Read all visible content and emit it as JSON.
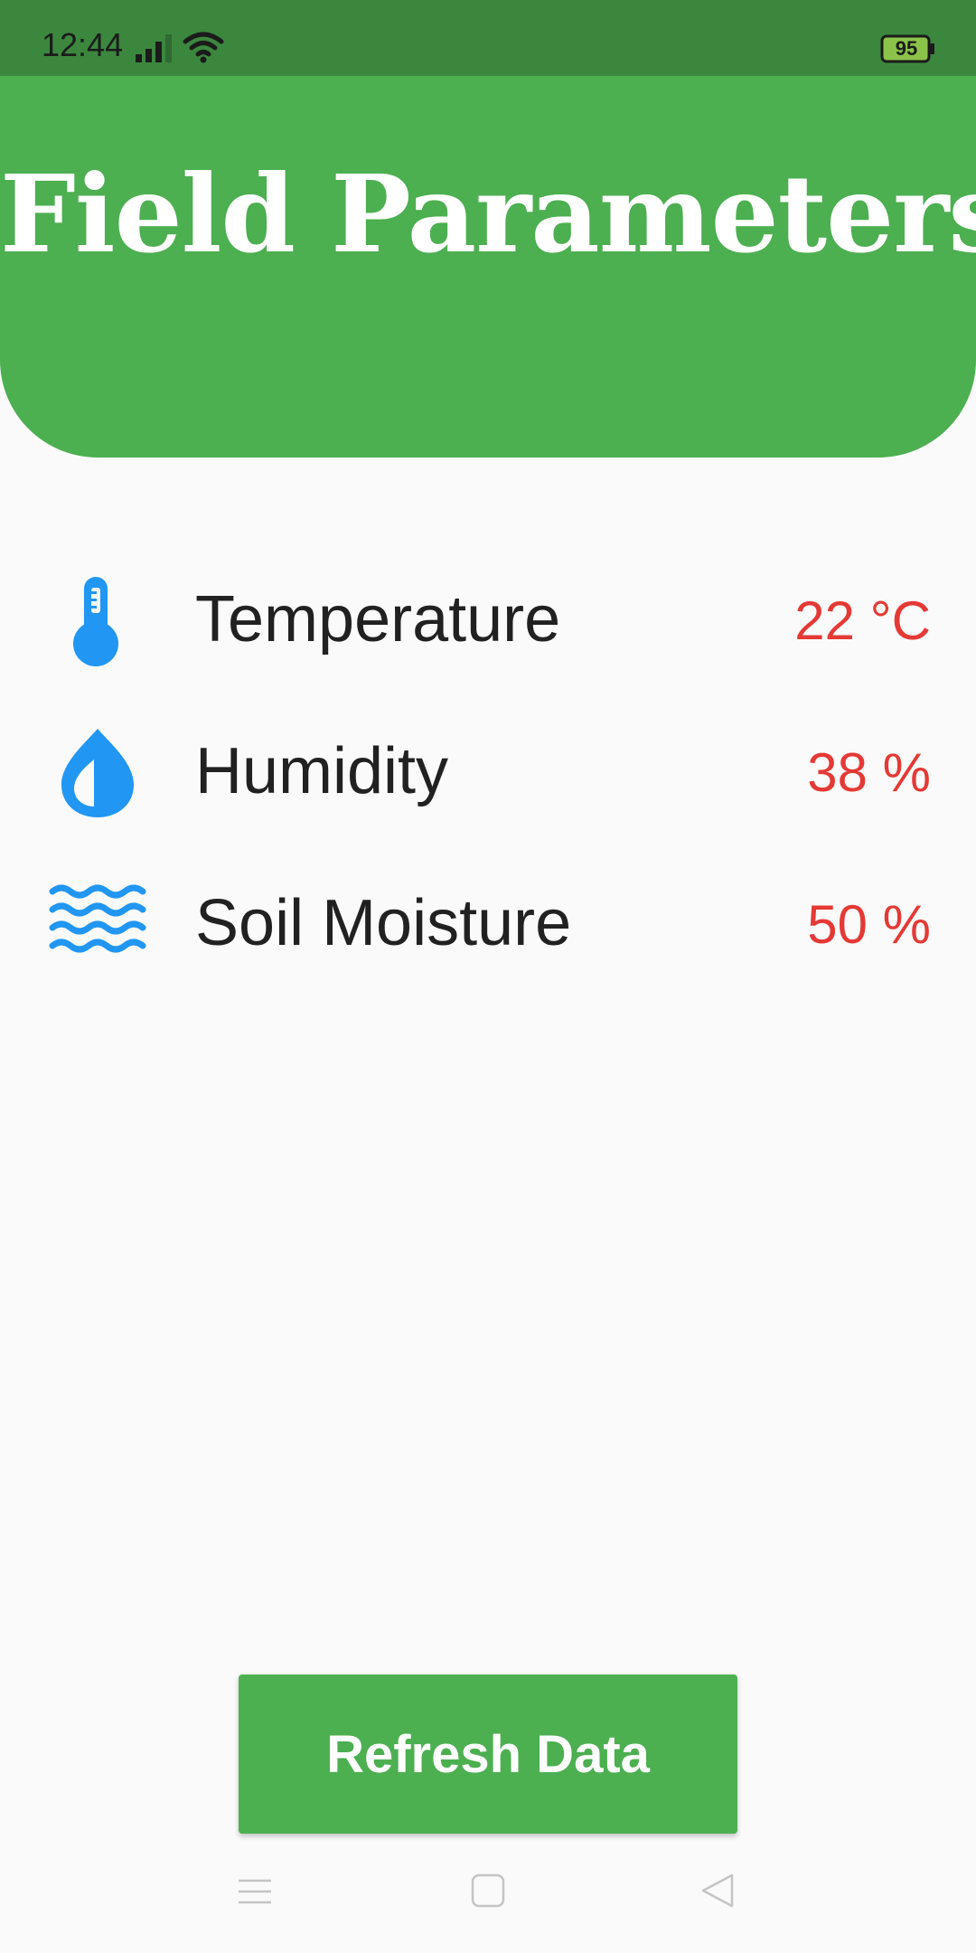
{
  "status_bar": {
    "time": "12:44",
    "battery_level": "95",
    "icons": [
      "signal-icon",
      "wifi-icon",
      "battery-icon"
    ]
  },
  "header": {
    "title": "Field Parameters"
  },
  "parameters": [
    {
      "icon": "thermometer-icon",
      "label": "Temperature",
      "value": "22 °C"
    },
    {
      "icon": "water-drop-icon",
      "label": "Humidity",
      "value": "38 %"
    },
    {
      "icon": "waves-icon",
      "label": "Soil Moisture",
      "value": "50 %"
    }
  ],
  "refresh_button": {
    "label": "Refresh Data"
  },
  "nav_bar": {
    "icons": [
      "menu-icon",
      "home-icon",
      "back-icon"
    ]
  },
  "colors": {
    "status_bar": "#3b873e",
    "header": "#4caf50",
    "icon": "#2196f3",
    "value": "#e53935",
    "label": "#212121",
    "button": "#4caf50"
  }
}
